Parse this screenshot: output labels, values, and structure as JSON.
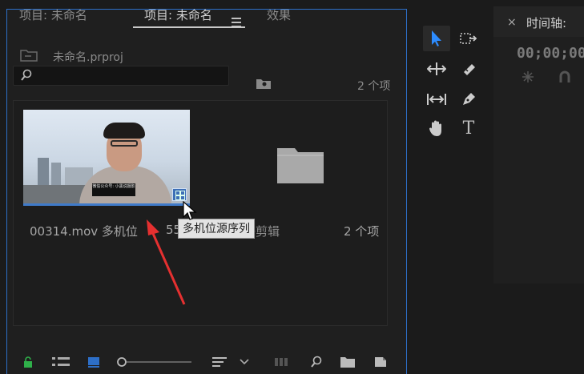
{
  "project_panel": {
    "tabs": [
      {
        "label": "项目: 未命名"
      },
      {
        "label": "项目: 未命名"
      },
      {
        "label": "效果"
      }
    ],
    "menu_icon": "hamburger-icon",
    "breadcrumb": "未命名.prproj",
    "search_placeholder": "",
    "item_count_top": "2 个项",
    "items": [
      {
        "name": "00314.mov 多机位",
        "duration": "55:",
        "thumbnail_caption": "微信公众号: 小黑说摄影",
        "badge_icon": "multicam-badge-icon"
      },
      {
        "name": "处理好剪辑",
        "type": "folder"
      }
    ],
    "item_count_bin": "2 个项",
    "tooltip": "多机位源序列",
    "accent_color": "#2d6fc8"
  },
  "tools": [
    {
      "name": "selection-tool-icon",
      "active": true
    },
    {
      "name": "track-select-tool-icon"
    },
    {
      "name": "ripple-edit-tool-icon"
    },
    {
      "name": "razor-tool-icon"
    },
    {
      "name": "slip-tool-icon"
    },
    {
      "name": "pen-tool-icon"
    },
    {
      "name": "hand-tool-icon"
    },
    {
      "name": "type-tool-icon",
      "glyph": "T"
    }
  ],
  "timeline_panel": {
    "close_glyph": "×",
    "title": "时间轴:",
    "timecode": "00;00;00"
  }
}
